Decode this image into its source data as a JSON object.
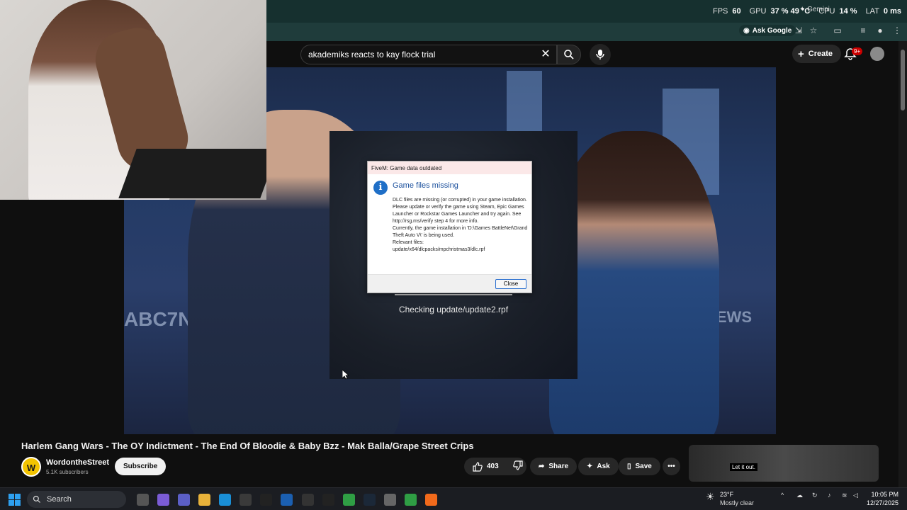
{
  "overlay": {
    "fps_label": "FPS",
    "fps_value": "60",
    "gpu_label": "GPU",
    "gpu_value": "37 % 49 °C",
    "cpu_label": "CPU",
    "cpu_value": "14 %",
    "lat_label": "LAT",
    "lat_value": "0 ms",
    "gemini": "Gemini"
  },
  "browser": {
    "ask_google": "Ask Google"
  },
  "youtube": {
    "search_value": "akademiks reacts to kay flock trial",
    "create_label": "Create",
    "notification_badge": "9+"
  },
  "video": {
    "channel_watermark": "ABC7NY",
    "news_watermark": "NEWS"
  },
  "fivem": {
    "status": "Checking update/update2.rpf",
    "dialog": {
      "title": "FiveM: Game data outdated",
      "heading": "Game files missing",
      "body": "DLC files are missing (or corrupted) in your game installation. Please update or verify the game using Steam, Epic Games Launcher or Rockstar Games Launcher and try again. See http://rsg.ms/verify step 4 for more info.\nCurrently, the game installation in 'D:\\Games BattleNet\\Grand Theft Auto V\\' is being used.\nRelevant files:\nupdate/x64/dlcpacks/mpchristmas3/dlc.rpf",
      "close_label": "Close"
    }
  },
  "watch": {
    "title": "Harlem Gang Wars - The OY Indictment - The End Of Bloodie & Baby Bzz - Mak Balla/Grape Street Crips",
    "channel_initial": "W",
    "channel_name": "WordontheStreet",
    "subscribers": "5.1K subscribers",
    "subscribe_label": "Subscribe",
    "likes": "403",
    "share_label": "Share",
    "ask_label": "Ask",
    "save_label": "Save",
    "thumb_caption": "Let it out."
  },
  "taskbar": {
    "search_placeholder": "Search",
    "weather_temp": "23°F",
    "weather_desc": "Mostly clear",
    "time": "10:05 PM",
    "date": "12/27/2025"
  },
  "colors": {
    "accent_blue": "#1f6fc7",
    "browser_chrome": "#1e3a3a",
    "yt_background": "#0f0f0f",
    "dialog_title_bg": "#fbe8e8"
  }
}
